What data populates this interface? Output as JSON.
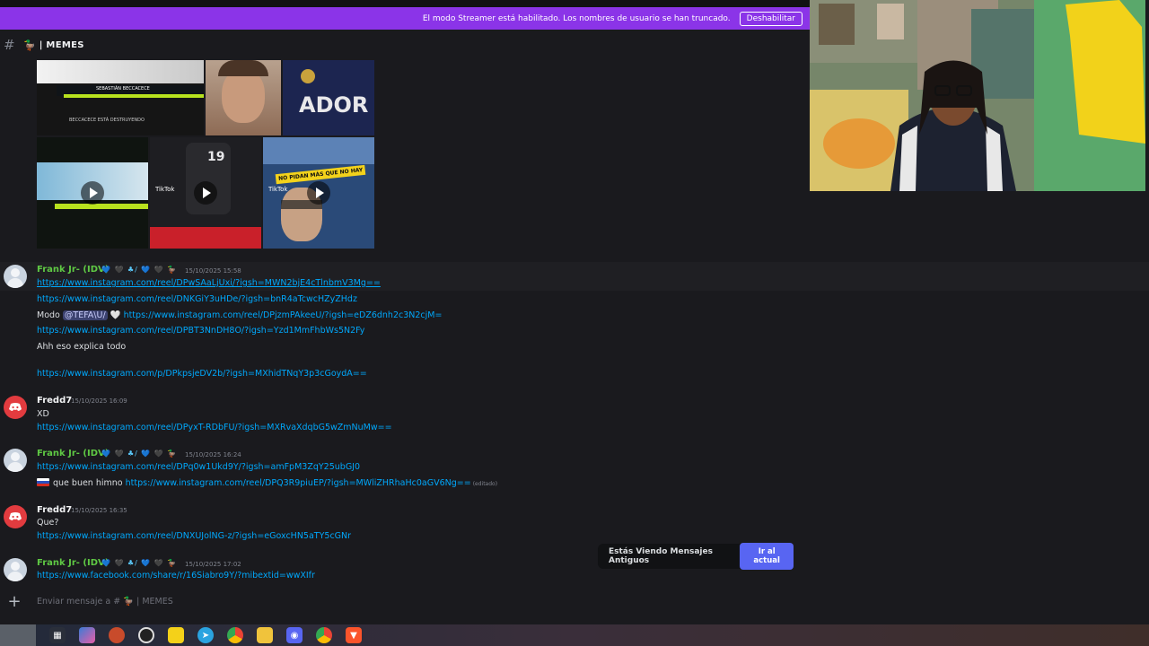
{
  "banner": {
    "text": "El modo Streamer está habilitado. Los nombres de usuario se han truncado.",
    "button": "Deshabilitar"
  },
  "channel": {
    "prefix": "#",
    "emoji": "🦆",
    "name": "| MEMES"
  },
  "messages": [
    {
      "author": "Frank Jr- (IDV)",
      "badges": "💙 🖤 ♣/ 💙 🖤 🦆",
      "timestamp": "15/10/2025 15:58",
      "lines": [
        "https://www.instagram.com/reel/DPwSAaLjUxi/?igsh=MWN2bjE4cTlnbmV3Mg==",
        "https://www.instagram.com/reel/DNKGiY3uHDe/?igsh=bnR4aTcwcHZyZHdz",
        "Modo",
        "@TEFA\\U/",
        "🤍",
        "https://www.instagram.com/reel/DPjzmPAkeeU/?igsh=eDZ6dnh2c3N2cjM=",
        "https://www.instagram.com/reel/DPBT3NnDH8O/?igsh=Yzd1MmFhbWs5N2Fy",
        "Ahh eso explica todo",
        "https://www.instagram.com/p/DPkpsjeDV2b/?igsh=MXhidTNqY3p3cGoydA=="
      ]
    },
    {
      "author": "Fredd7",
      "timestamp": "15/10/2025 16:09",
      "lines": [
        "XD",
        "https://www.instagram.com/reel/DPyxT-RDbFU/?igsh=MXRvaXdqbG5wZmNuMw=="
      ]
    },
    {
      "author": "Frank Jr- (IDV)",
      "badges": "💙 🖤 ♣/ 💙 🖤 🦆",
      "timestamp": "15/10/2025 16:24",
      "lines": [
        "https://www.instagram.com/reel/DPq0w1Ukd9Y/?igsh=amFpM3ZqY25ubGJ0",
        "que buen himno",
        "https://www.instagram.com/reel/DPQ3R9piuEP/?igsh=MWliZHRhaHc0aGV6Ng==",
        "(editado)"
      ]
    },
    {
      "author": "Fredd7",
      "timestamp": "15/10/2025 16:35",
      "lines": [
        "Que?",
        "https://www.instagram.com/reel/DNXUJolNG-z/?igsh=eGoxcHN5aTY5cGNr"
      ]
    },
    {
      "author": "Frank Jr- (IDV)",
      "badges": "💙 🖤 ♣/ 💙 🖤 🦆",
      "timestamp": "15/10/2025 17:02",
      "lines": [
        "https://www.facebook.com/share/r/16Siabro9Y/?mibextid=wwXIfr"
      ]
    }
  ],
  "media": {
    "thumb1_text": "SEBASTIÁN BECCACECE",
    "thumb1_caption": "BECCACECE ESTÁ DESTRUYENDO",
    "thumb3_text": "ADOR",
    "thumb5_number": "19",
    "thumb6_sticker": "NO PIDAN MÁS QUE NO HAY",
    "tiktok": "TikTok"
  },
  "jump_pill": {
    "text": "Estás Viendo Mensajes Antiguos",
    "button": "Ir al actual"
  },
  "composer": {
    "placeholder": "Enviar mensaje a # 🦆 | MEMES"
  }
}
